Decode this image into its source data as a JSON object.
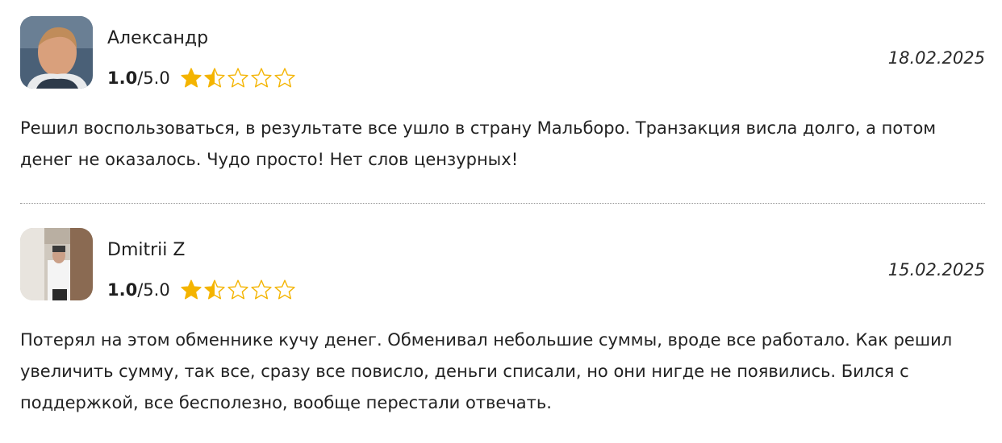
{
  "reviews": [
    {
      "author": "Александр",
      "score": "1.0",
      "max_score": "/5.0",
      "rating": 1.5,
      "date": "18.02.2025",
      "text": "Решил воспользоваться, в результате все ушло в страну Мальборо. Транзакция висла долго, а потом денег не оказалось. Чудо просто! Нет слов цензурных!"
    },
    {
      "author": "Dmitrii Z",
      "score": "1.0",
      "max_score": "/5.0",
      "rating": 1.5,
      "date": "15.02.2025",
      "text": "Потерял на этом обменнике кучу денег. Обменивал небольшие суммы, вроде все работало. Как решил увеличить сумму, так все, сразу все повисло, деньги списали, но они нигде не появились. Бился с поддержкой, все бесполезно, вообще перестали отвечать."
    }
  ],
  "colors": {
    "star_fill": "#f4b400",
    "star_outline": "#f4b400",
    "divider": "#9a9a9a"
  },
  "icons": {
    "star_full": "star-full-icon",
    "star_half": "star-half-icon",
    "star_empty": "star-empty-icon"
  }
}
